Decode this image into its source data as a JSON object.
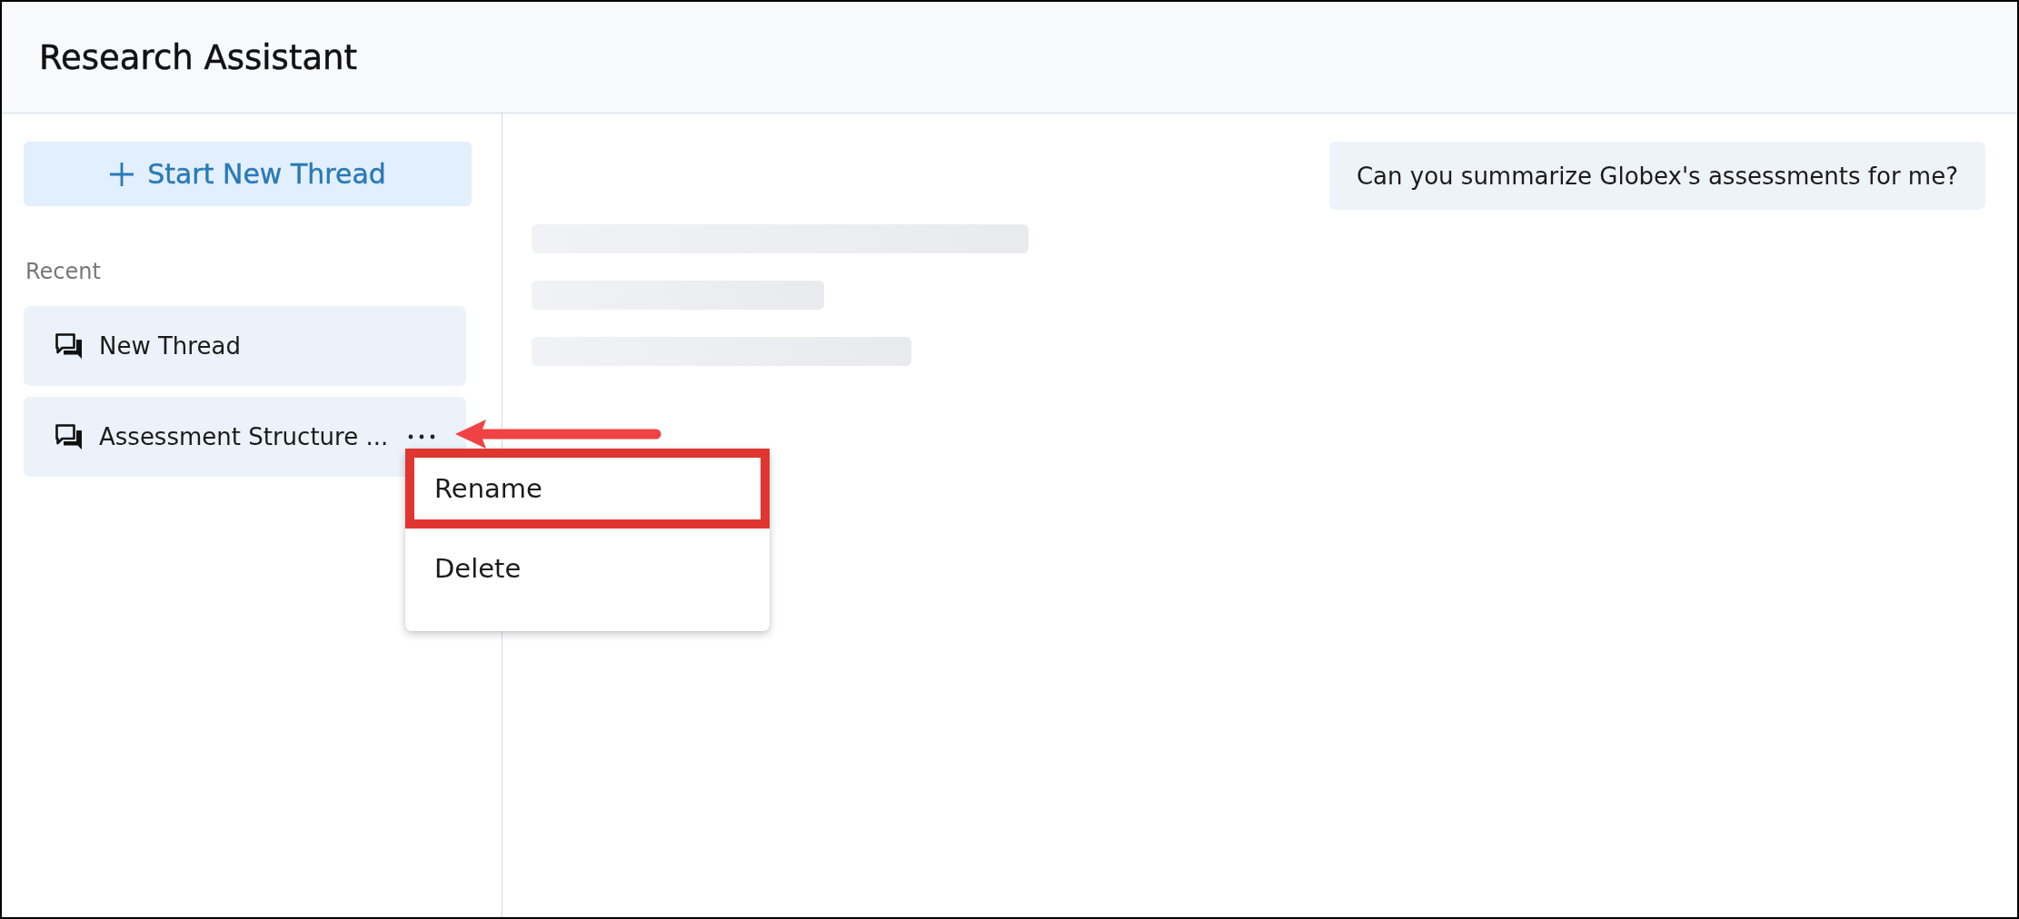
{
  "window": {
    "title": "Research Assistant"
  },
  "sidebar": {
    "new_thread_button": {
      "label": "Start New Thread"
    },
    "section_label": "Recent",
    "threads": [
      {
        "title": "New Thread",
        "menu_open": false
      },
      {
        "title": "Assessment Structure ...",
        "menu_open": true
      }
    ]
  },
  "context_menu": {
    "items": [
      {
        "label": "Rename",
        "highlighted": true
      },
      {
        "label": "Delete",
        "highlighted": false
      }
    ],
    "callout_arrow": true
  },
  "conversation": {
    "messages": [
      {
        "kind": "user",
        "text": "Can you summarize Globex's assessments for me?"
      },
      {
        "kind": "loading"
      }
    ]
  }
}
